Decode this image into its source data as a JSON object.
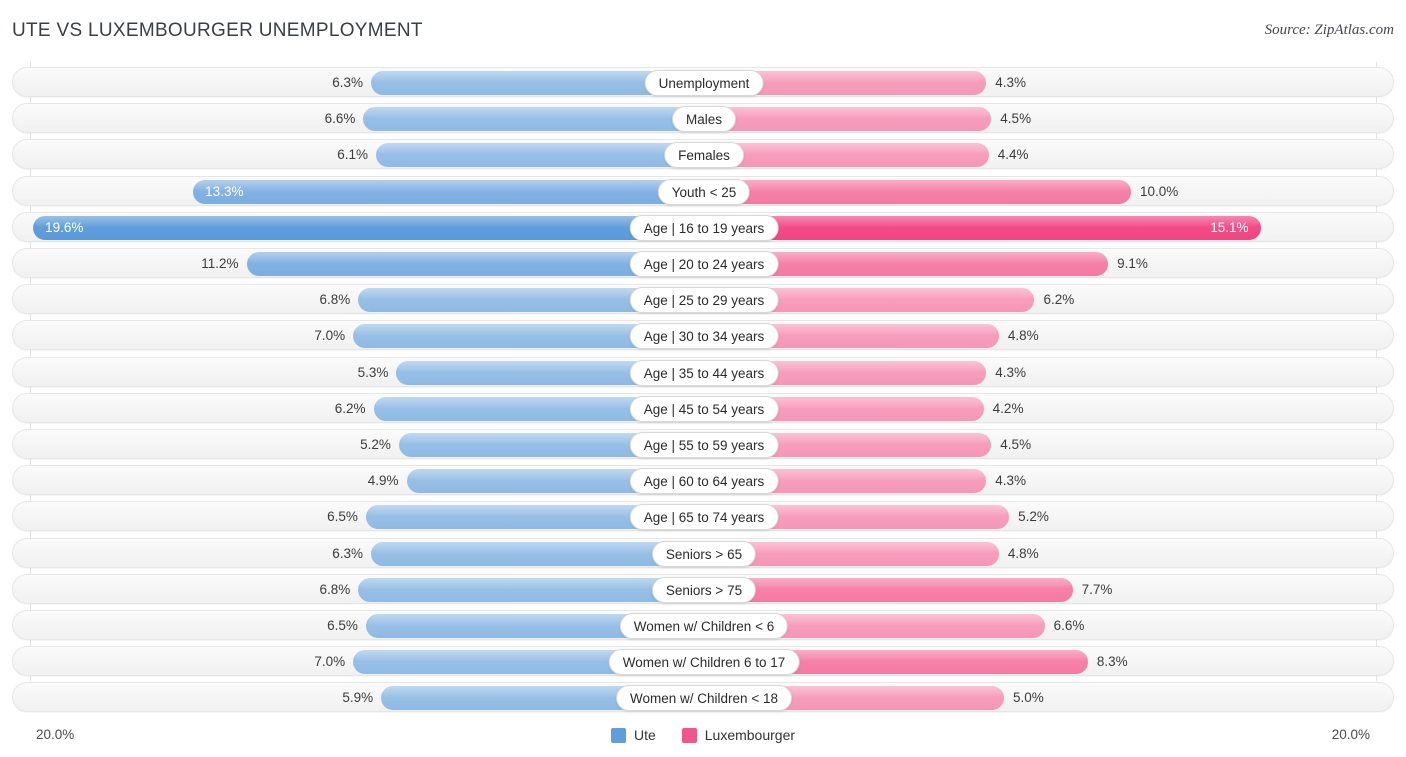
{
  "header": {
    "title": "UTE VS LUXEMBOURGER UNEMPLOYMENT",
    "source": "Source: ZipAtlas.com"
  },
  "footer": {
    "axis_left": "20.0%",
    "axis_right": "20.0%",
    "legend": [
      {
        "label": "Ute",
        "color": "#5f9edb"
      },
      {
        "label": "Luxembourger",
        "color": "#f2548c"
      }
    ]
  },
  "chart_data": {
    "type": "bar",
    "subtype": "diverging-bidirectional",
    "title": "UTE VS LUXEMBOURGER UNEMPLOYMENT",
    "xlabel": "",
    "ylabel": "",
    "xlim": [
      20.0,
      20.0
    ],
    "axis_max_percent": 20.0,
    "grid": true,
    "legend_position": "bottom-center",
    "categories": [
      "Unemployment",
      "Males",
      "Females",
      "Youth < 25",
      "Age | 16 to 19 years",
      "Age | 20 to 24 years",
      "Age | 25 to 29 years",
      "Age | 30 to 34 years",
      "Age | 35 to 44 years",
      "Age | 45 to 54 years",
      "Age | 55 to 59 years",
      "Age | 60 to 64 years",
      "Age | 65 to 74 years",
      "Seniors > 65",
      "Seniors > 75",
      "Women w/ Children < 6",
      "Women w/ Children 6 to 17",
      "Women w/ Children < 18"
    ],
    "series": [
      {
        "name": "Ute",
        "color": "#97bfe6",
        "side": "left",
        "values": [
          6.3,
          6.6,
          6.1,
          13.3,
          19.6,
          11.2,
          6.8,
          7.0,
          5.3,
          6.2,
          5.2,
          4.9,
          6.5,
          6.3,
          6.8,
          6.5,
          7.0,
          5.9
        ],
        "labels": [
          "6.3%",
          "6.6%",
          "6.1%",
          "13.3%",
          "19.6%",
          "11.2%",
          "6.8%",
          "7.0%",
          "5.3%",
          "6.2%",
          "5.2%",
          "4.9%",
          "6.5%",
          "6.3%",
          "6.8%",
          "6.5%",
          "7.0%",
          "5.9%"
        ]
      },
      {
        "name": "Luxembourger",
        "color": "#f79dbc",
        "side": "right",
        "values": [
          4.3,
          4.5,
          4.4,
          10.0,
          15.1,
          9.1,
          6.2,
          4.8,
          4.3,
          4.2,
          4.5,
          4.3,
          5.2,
          4.8,
          7.7,
          6.6,
          8.3,
          5.0
        ],
        "labels": [
          "4.3%",
          "4.5%",
          "4.4%",
          "10.0%",
          "15.1%",
          "9.1%",
          "6.2%",
          "4.8%",
          "4.3%",
          "4.2%",
          "4.5%",
          "4.3%",
          "5.2%",
          "4.8%",
          "7.7%",
          "6.6%",
          "8.3%",
          "5.0%"
        ]
      }
    ]
  },
  "rows": [
    {
      "label": "Unemployment",
      "left": "6.3%",
      "right": "4.3%",
      "lv": 6.3,
      "rv": 4.3,
      "lstyle": "blue",
      "rstyle": "pink",
      "lin": false,
      "rin": false
    },
    {
      "label": "Males",
      "left": "6.6%",
      "right": "4.5%",
      "lv": 6.6,
      "rv": 4.5,
      "lstyle": "blue",
      "rstyle": "pink",
      "lin": false,
      "rin": false
    },
    {
      "label": "Females",
      "left": "6.1%",
      "right": "4.4%",
      "lv": 6.1,
      "rv": 4.4,
      "lstyle": "blue",
      "rstyle": "pink",
      "lin": false,
      "rin": false
    },
    {
      "label": "Youth < 25",
      "left": "13.3%",
      "right": "10.0%",
      "lv": 13.3,
      "rv": 10.0,
      "lstyle": "blue-mid",
      "rstyle": "pink-mid",
      "lin": true,
      "rin": false
    },
    {
      "label": "Age | 16 to 19 years",
      "left": "19.6%",
      "right": "15.1%",
      "lv": 19.6,
      "rv": 15.1,
      "lstyle": "blue-max",
      "rstyle": "pink-max",
      "lin": true,
      "rin": true
    },
    {
      "label": "Age | 20 to 24 years",
      "left": "11.2%",
      "right": "9.1%",
      "lv": 11.2,
      "rv": 9.1,
      "lstyle": "blue-mid",
      "rstyle": "pink-mid",
      "lin": false,
      "rin": false
    },
    {
      "label": "Age | 25 to 29 years",
      "left": "6.8%",
      "right": "6.2%",
      "lv": 6.8,
      "rv": 6.2,
      "lstyle": "blue",
      "rstyle": "pink",
      "lin": false,
      "rin": false
    },
    {
      "label": "Age | 30 to 34 years",
      "left": "7.0%",
      "right": "4.8%",
      "lv": 7.0,
      "rv": 4.8,
      "lstyle": "blue",
      "rstyle": "pink",
      "lin": false,
      "rin": false
    },
    {
      "label": "Age | 35 to 44 years",
      "left": "5.3%",
      "right": "4.3%",
      "lv": 5.3,
      "rv": 4.3,
      "lstyle": "blue",
      "rstyle": "pink",
      "lin": false,
      "rin": false
    },
    {
      "label": "Age | 45 to 54 years",
      "left": "6.2%",
      "right": "4.2%",
      "lv": 6.2,
      "rv": 4.2,
      "lstyle": "blue",
      "rstyle": "pink",
      "lin": false,
      "rin": false
    },
    {
      "label": "Age | 55 to 59 years",
      "left": "5.2%",
      "right": "4.5%",
      "lv": 5.2,
      "rv": 4.5,
      "lstyle": "blue",
      "rstyle": "pink",
      "lin": false,
      "rin": false
    },
    {
      "label": "Age | 60 to 64 years",
      "left": "4.9%",
      "right": "4.3%",
      "lv": 4.9,
      "rv": 4.3,
      "lstyle": "blue",
      "rstyle": "pink",
      "lin": false,
      "rin": false
    },
    {
      "label": "Age | 65 to 74 years",
      "left": "6.5%",
      "right": "5.2%",
      "lv": 6.5,
      "rv": 5.2,
      "lstyle": "blue",
      "rstyle": "pink",
      "lin": false,
      "rin": false
    },
    {
      "label": "Seniors > 65",
      "left": "6.3%",
      "right": "4.8%",
      "lv": 6.3,
      "rv": 4.8,
      "lstyle": "blue",
      "rstyle": "pink",
      "lin": false,
      "rin": false
    },
    {
      "label": "Seniors > 75",
      "left": "6.8%",
      "right": "7.7%",
      "lv": 6.8,
      "rv": 7.7,
      "lstyle": "blue",
      "rstyle": "pink-mid",
      "lin": false,
      "rin": false
    },
    {
      "label": "Women w/ Children < 6",
      "left": "6.5%",
      "right": "6.6%",
      "lv": 6.5,
      "rv": 6.6,
      "lstyle": "blue",
      "rstyle": "pink",
      "lin": false,
      "rin": false
    },
    {
      "label": "Women w/ Children 6 to 17",
      "left": "7.0%",
      "right": "8.3%",
      "lv": 7.0,
      "rv": 8.3,
      "lstyle": "blue",
      "rstyle": "pink-mid",
      "lin": false,
      "rin": false
    },
    {
      "label": "Women w/ Children < 18",
      "left": "5.9%",
      "right": "5.0%",
      "lv": 5.9,
      "rv": 5.0,
      "lstyle": "blue",
      "rstyle": "pink",
      "lin": false,
      "rin": false
    }
  ]
}
